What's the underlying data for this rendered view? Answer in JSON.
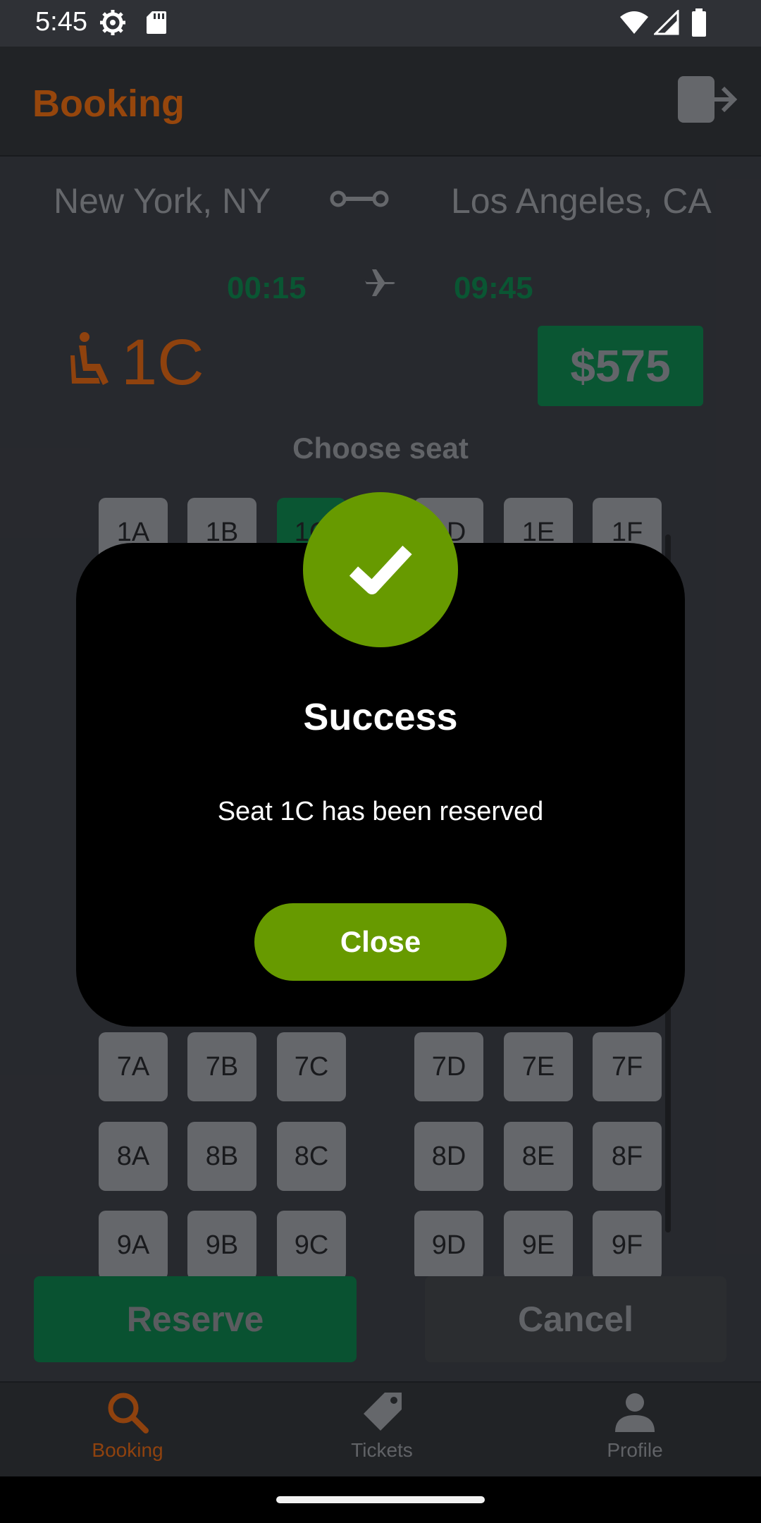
{
  "status_bar": {
    "time": "5:45",
    "icons": [
      "gear-icon",
      "sd-card-icon",
      "wifi-icon",
      "signal-icon",
      "battery-icon"
    ]
  },
  "header": {
    "title": "Booking",
    "logout_icon": "logout-icon"
  },
  "route": {
    "origin": "New York, NY",
    "destination": "Los Angeles, CA",
    "depart_time": "00:15",
    "arrive_time": "09:45"
  },
  "selection": {
    "seat": "1C",
    "price": "$575"
  },
  "seat_section": {
    "heading": "Choose seat",
    "rows": [
      [
        "1A",
        "1B",
        "1C",
        "1D",
        "1E",
        "1F"
      ],
      [
        "7A",
        "7B",
        "7C",
        "7D",
        "7E",
        "7F"
      ],
      [
        "8A",
        "8B",
        "8C",
        "8D",
        "8E",
        "8F"
      ],
      [
        "9A",
        "9B",
        "9C",
        "9D",
        "9E",
        "9F"
      ]
    ],
    "selected": "1C"
  },
  "actions": {
    "reserve": "Reserve",
    "cancel": "Cancel"
  },
  "bottom_nav": {
    "items": [
      {
        "label": "Booking",
        "icon": "search-icon",
        "active": true
      },
      {
        "label": "Tickets",
        "icon": "ticket-tag-icon",
        "active": false
      },
      {
        "label": "Profile",
        "icon": "person-icon",
        "active": false
      }
    ]
  },
  "dialog": {
    "title": "Success",
    "message": "Seat 1C has been reserved",
    "close": "Close",
    "icon": "checkmark-icon"
  },
  "colors": {
    "accent_orange": "#a34d0e",
    "green": "#0b5e38",
    "success_green": "#679a00"
  }
}
